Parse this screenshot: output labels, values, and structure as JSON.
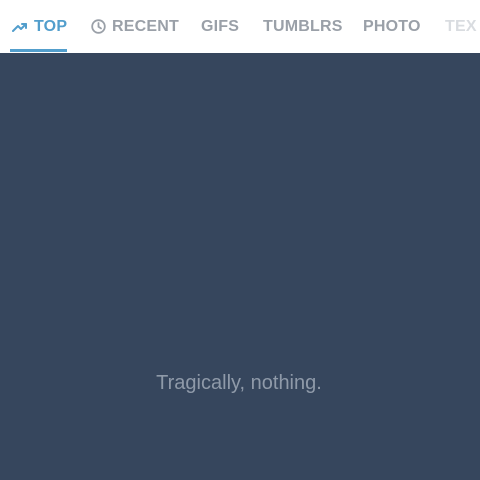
{
  "tabs": [
    {
      "id": "top",
      "label": "TOP",
      "icon": "trending-icon",
      "active": true
    },
    {
      "id": "recent",
      "label": "RECENT",
      "icon": "clock-icon",
      "active": false
    },
    {
      "id": "gifs",
      "label": "GIFS",
      "active": false
    },
    {
      "id": "tumblrs",
      "label": "TUMBLRS",
      "active": false
    },
    {
      "id": "photo",
      "label": "PHOTO",
      "active": false
    },
    {
      "id": "text",
      "label": "TEX",
      "active": false
    }
  ],
  "content": {
    "empty_message": "Tragically, nothing."
  },
  "colors": {
    "accent": "#529ecc",
    "background": "#36465d",
    "tab_inactive": "#9aa0a8",
    "empty_text": "#8f9aa9"
  }
}
